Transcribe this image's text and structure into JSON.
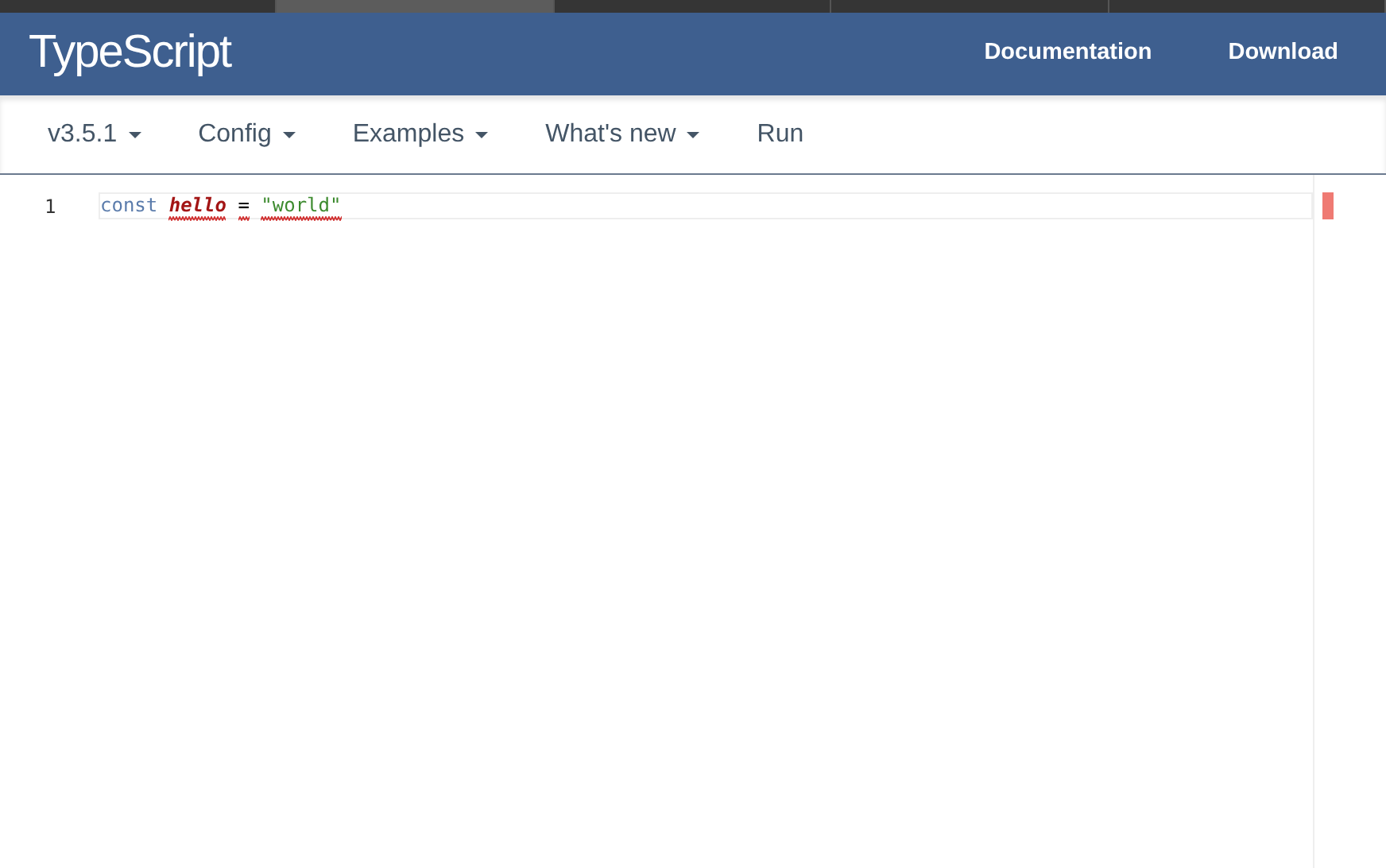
{
  "browser_tabs": [
    {
      "selected": false
    },
    {
      "selected": true
    },
    {
      "selected": false
    },
    {
      "selected": false
    },
    {
      "selected": false
    }
  ],
  "header": {
    "logo": "TypeScript",
    "links": [
      "Documentation",
      "Download"
    ]
  },
  "toolbar": [
    {
      "label": "v3.5.1",
      "kind": "dropdown"
    },
    {
      "label": "Config",
      "kind": "dropdown"
    },
    {
      "label": "Examples",
      "kind": "dropdown"
    },
    {
      "label": "What's new",
      "kind": "dropdown"
    },
    {
      "label": "Run",
      "kind": "button"
    }
  ],
  "editor": {
    "lines": [
      {
        "number": "1",
        "tokens": [
          {
            "text": "const",
            "kind": "keyword",
            "error": false
          },
          {
            "text": "hello",
            "kind": "identifier",
            "error": true
          },
          {
            "text": "=",
            "kind": "operator",
            "error": true
          },
          {
            "text": "\"world\"",
            "kind": "string",
            "error": true
          }
        ]
      }
    ],
    "error_marker": true
  }
}
